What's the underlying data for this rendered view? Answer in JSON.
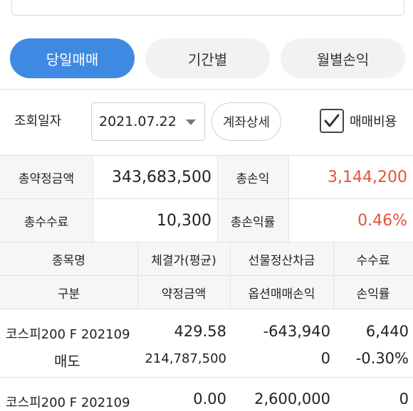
{
  "tabs": [
    "당일매매",
    "기간별",
    "월별손익"
  ],
  "query": {
    "label": "조회일자",
    "date": "2021.07.22",
    "detail_button": "계좌상세",
    "checkbox_label": "매매비용",
    "checkbox_checked": true
  },
  "summary": {
    "total_contract_label": "총약정금액",
    "total_contract_value": "343,683,500",
    "total_pl_label": "총손익",
    "total_pl_value": "3,144,200",
    "total_fee_label": "총수수료",
    "total_fee_value": "10,300",
    "total_pl_rate_label": "총손익률",
    "total_pl_rate_value": "0.46%"
  },
  "table": {
    "header_row1": [
      "종목명",
      "체결가(평균)",
      "선물정산차금",
      "수수료"
    ],
    "header_row2": [
      "구분",
      "약정금액",
      "옵션매매손익",
      "손익률"
    ],
    "rows": [
      {
        "name": "코스피200 F 202109",
        "price": "429.58",
        "futures_settlement": "-643,940",
        "fee": "6,440",
        "side": "매도",
        "contract_amount": "214,787,500",
        "option_pl": "0",
        "pl_rate": "-0.30%"
      },
      {
        "name": "코스피200 F 202109",
        "price": "0.00",
        "futures_settlement": "2,600,000",
        "fee": "0"
      }
    ]
  },
  "colors": {
    "accent": "#3e8ae3",
    "positive": "#e2533d",
    "negative": "#2f7fd6"
  }
}
